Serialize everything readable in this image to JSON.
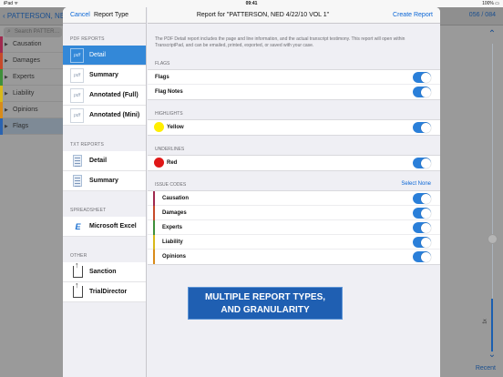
{
  "status_bar": {
    "left": "iPad ᯤ",
    "time": "09:41",
    "right": "100% ▭"
  },
  "background_app": {
    "back_label": "‹ PATTERSON, NED",
    "search_placeholder": "Search PATTER…",
    "page_indicator": "056 / 084",
    "recent_label": "Recent",
    "zoom_label": "1x",
    "issues": [
      {
        "label": "Causation",
        "color": "#a0294e"
      },
      {
        "label": "Damages",
        "color": "#c64a2a"
      },
      {
        "label": "Experts",
        "color": "#3f8f3a"
      },
      {
        "label": "Liability",
        "color": "#d8b81a"
      },
      {
        "label": "Opinions",
        "color": "#d88b1a"
      },
      {
        "label": "Flags",
        "color": "#2a63b0"
      }
    ]
  },
  "left_pane": {
    "cancel_label": "Cancel",
    "title": "Report Type",
    "sections": {
      "pdf": "PDF REPORTS",
      "txt": "TXT REPORTS",
      "spreadsheet": "SPREADSHEET",
      "other": "OTHER"
    },
    "pdf_items": [
      "Detail",
      "Summary",
      "Annotated (Full)",
      "Annotated (Mini)"
    ],
    "pdf_icon_text": "pdf",
    "txt_items": [
      "Detail",
      "Summary"
    ],
    "spreadsheet_items": [
      "Microsoft Excel"
    ],
    "excel_icon_text": "E",
    "other_items": [
      "Sanction",
      "TrialDirector"
    ]
  },
  "right_pane": {
    "title": "Report for \"PATTERSON, NED 4/22/10 VOL 1\"",
    "create_label": "Create Report",
    "description": "The PDF Detail report includes the page and line information, and the actual transcript testimony. This report will open within TranscriptPad, and can be emailed, printed, exported, or saved with your case.",
    "flags_section": "FLAGS",
    "flags": [
      "Flags",
      "Flag Notes"
    ],
    "highlights_section": "HIGHLIGHTS",
    "highlights": [
      {
        "label": "Yellow",
        "color": "#ffee00"
      }
    ],
    "underlines_section": "UNDERLINES",
    "underlines": [
      {
        "label": "Red",
        "color": "#e01818"
      }
    ],
    "issue_codes_section": "ISSUE CODES",
    "select_none_label": "Select None",
    "issue_codes": [
      {
        "label": "Causation",
        "color": "#a0294e"
      },
      {
        "label": "Damages",
        "color": "#c64a2a"
      },
      {
        "label": "Experts",
        "color": "#3f8f3a"
      },
      {
        "label": "Liability",
        "color": "#d8b81a"
      },
      {
        "label": "Opinions",
        "color": "#d88b1a"
      }
    ]
  },
  "banner": {
    "line1": "MULTIPLE REPORT TYPES,",
    "line2": "AND GRANULARITY"
  }
}
